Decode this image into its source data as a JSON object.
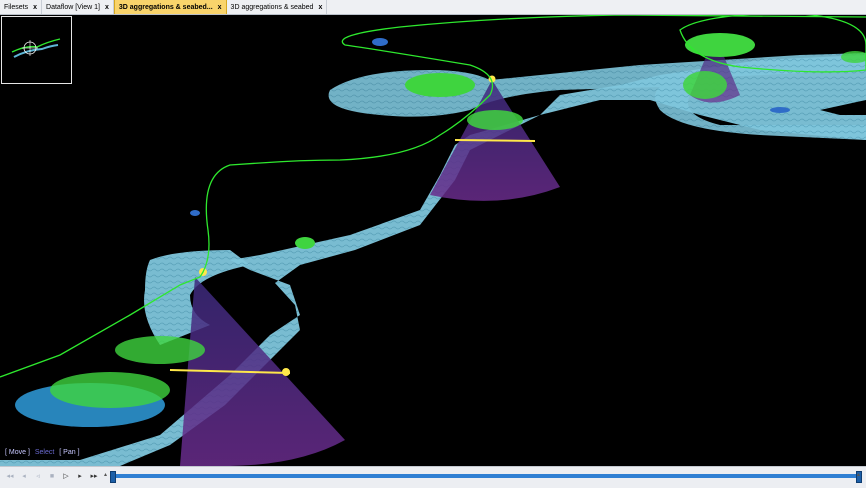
{
  "tabs": [
    {
      "label": "Filesets",
      "close": "x",
      "active": false
    },
    {
      "label": "Dataflow [View 1]",
      "close": "x",
      "active": false
    },
    {
      "label": "3D aggregations & seabed...",
      "close": "x",
      "active": true
    },
    {
      "label": "3D aggregations & seabed",
      "close": "x",
      "active": false
    }
  ],
  "viewport": {
    "modes": {
      "move": "[ Move ]",
      "select": "Select",
      "pan": "[ Pan ]"
    }
  },
  "playback": {
    "buttons": [
      {
        "name": "rewind-fast-button",
        "glyph": "◂◂",
        "dim": true
      },
      {
        "name": "step-back-button",
        "glyph": "◂",
        "dim": true
      },
      {
        "name": "back-button",
        "glyph": "◃",
        "dim": true
      },
      {
        "name": "stop-button",
        "glyph": "■",
        "dim": true
      },
      {
        "name": "play-button",
        "glyph": "▷",
        "dim": false
      },
      {
        "name": "step-forward-button",
        "glyph": "▸",
        "dim": false
      },
      {
        "name": "forward-fast-button",
        "glyph": "▸▸",
        "dim": false
      }
    ],
    "timeline_marker_left": "▴",
    "timeline_marker_right": "▴"
  },
  "colors": {
    "seabed": "#7fc6dc",
    "track": "#2ee82e",
    "aggregation": "#3fd43f",
    "beam": "#5a2a8a",
    "accent": "#f9d46b",
    "timeline": "#2f7fd3"
  }
}
